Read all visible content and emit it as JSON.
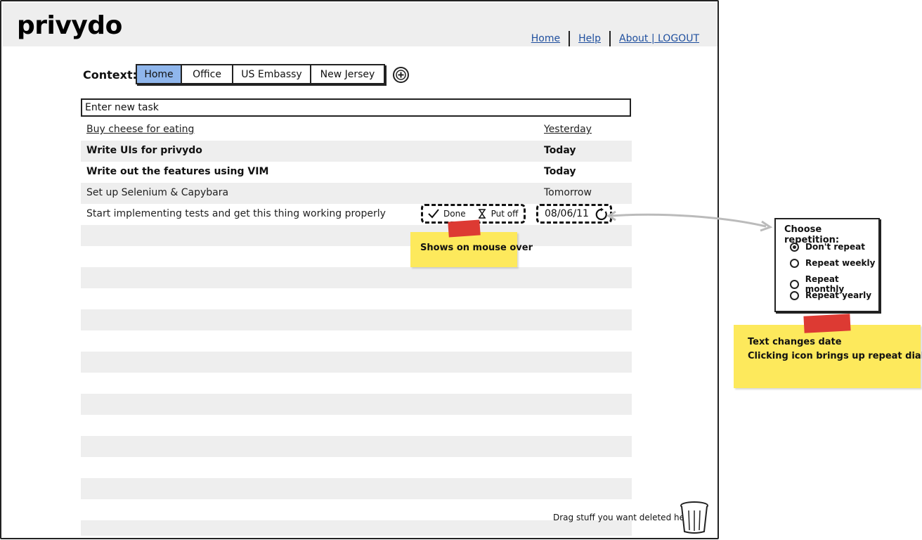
{
  "app": {
    "logo": "privydo"
  },
  "nav": {
    "home": "Home",
    "help": "Help",
    "about": "About | LOGOUT"
  },
  "context": {
    "label": "Context:",
    "tabs": [
      "Home",
      "Office",
      "US Embassy",
      "New Jersey"
    ],
    "active": "Home",
    "add_icon": "plus-circle-icon"
  },
  "new_task": {
    "placeholder": "Enter new task"
  },
  "tasks": [
    {
      "title": "Buy cheese for eating",
      "due": "Yesterday",
      "status": "overdue"
    },
    {
      "title": "Write UIs for privydo",
      "due": "Today",
      "status": "today"
    },
    {
      "title": "Write out the features using VIM",
      "due": "Today",
      "status": "today"
    },
    {
      "title": "Set up Selenium & Capybara",
      "due": "Tomorrow",
      "status": "upcoming"
    },
    {
      "title": "Start implementing tests and get this thing working properly",
      "due": "08/06/11",
      "status": "hover"
    }
  ],
  "hover_actions": {
    "done": "Done",
    "put_off": "Put off",
    "done_icon": "checkmark-icon",
    "put_off_icon": "hourglass-icon",
    "repeat_icon": "repeat-icon"
  },
  "notes": {
    "mouse_over": "Shows on mouse over",
    "date_line1": "Text changes date",
    "date_line2": "Clicking icon brings up repeat dialog"
  },
  "repeat_dialog": {
    "title": "Choose repetition:",
    "options": [
      "Don't repeat",
      "Repeat weekly",
      "Repeat monthly",
      "Repeat yearly"
    ],
    "selected": "Don't repeat"
  },
  "trash": {
    "label": "Drag stuff you want deleted here",
    "icon": "trash-can-icon"
  },
  "colors": {
    "active_tab": "#8fb6ec",
    "link": "#1f4f9e",
    "sticky": "#fde95c",
    "tape": "#dd3a33",
    "stripe": "#eeeeee"
  }
}
